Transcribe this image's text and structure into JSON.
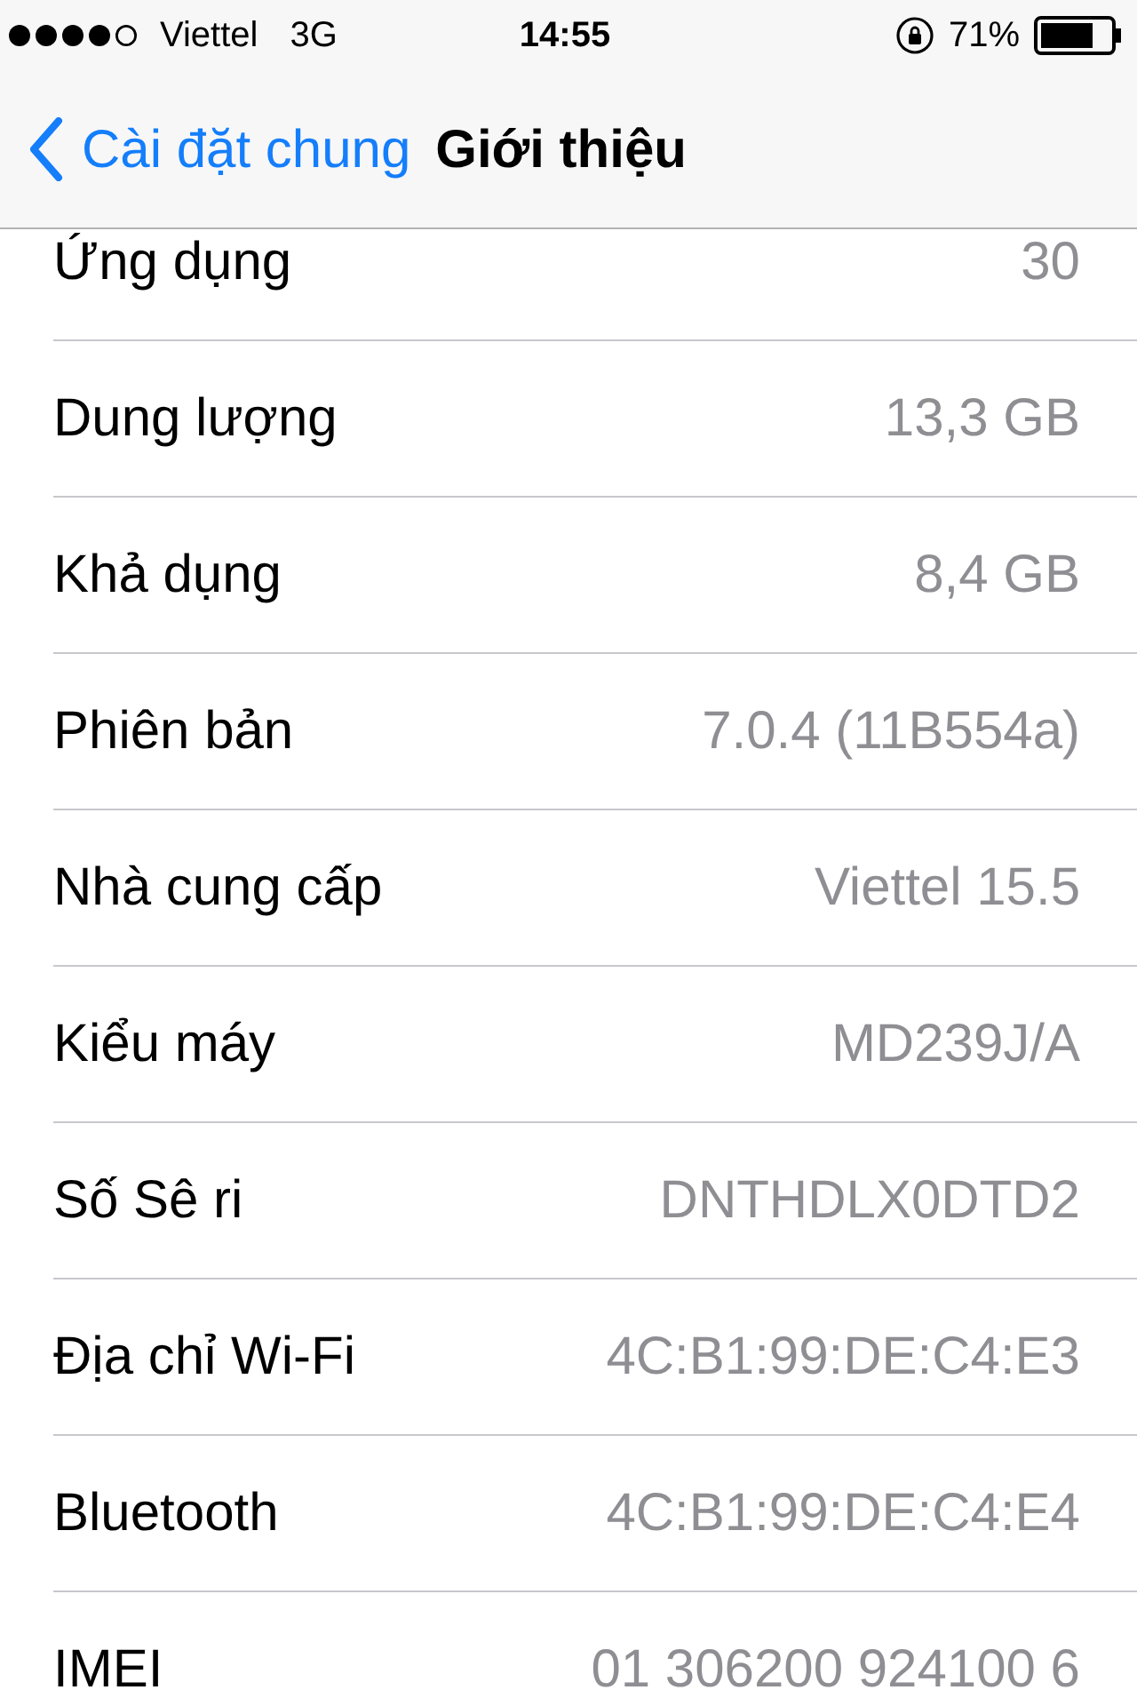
{
  "status_bar": {
    "carrier": "Viettel",
    "network": "3G",
    "time": "14:55",
    "battery": "71%"
  },
  "nav_bar": {
    "back": "Cài đặt chung",
    "title": "Giới thiệu"
  },
  "rows": [
    {
      "label": "Ứng dụng",
      "value": "30"
    },
    {
      "label": "Dung lượng",
      "value": "13,3 GB"
    },
    {
      "label": "Khả dụng",
      "value": "8,4 GB"
    },
    {
      "label": "Phiên bản",
      "value": "7.0.4 (11B554a)"
    },
    {
      "label": "Nhà cung cấp",
      "value": "Viettel 15.5"
    },
    {
      "label": "Kiểu máy",
      "value": "MD239J/A"
    },
    {
      "label": "Số Sê ri",
      "value": "DNTHDLX0DTD2"
    },
    {
      "label": "Địa chỉ Wi-Fi",
      "value": "4C:B1:99:DE:C4:E3"
    },
    {
      "label": "Bluetooth",
      "value": "4C:B1:99:DE:C4:E4"
    },
    {
      "label": "IMEI",
      "value": "01 306200 924100 6"
    }
  ]
}
